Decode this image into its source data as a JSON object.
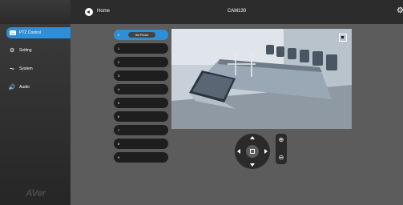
{
  "topbar": {
    "home_label": "Home",
    "title": "CAM130"
  },
  "sidebar": {
    "items": [
      {
        "label": "PTZ Control",
        "icon": "ptz-icon",
        "active": true
      },
      {
        "label": "Setting",
        "icon": "gear-icon"
      },
      {
        "label": "System",
        "icon": "pulse-icon"
      },
      {
        "label": "Audio",
        "icon": "speaker-icon"
      }
    ],
    "logo": "AVer"
  },
  "presets": {
    "set_label": "Set Preset",
    "items": [
      "0",
      "1",
      "2",
      "3",
      "4",
      "5",
      "6",
      "7",
      "8",
      "9"
    ]
  },
  "colors": {
    "accent": "#2e8ed8",
    "background": "#5c5c5c",
    "topbar": "#2c2c2c"
  }
}
